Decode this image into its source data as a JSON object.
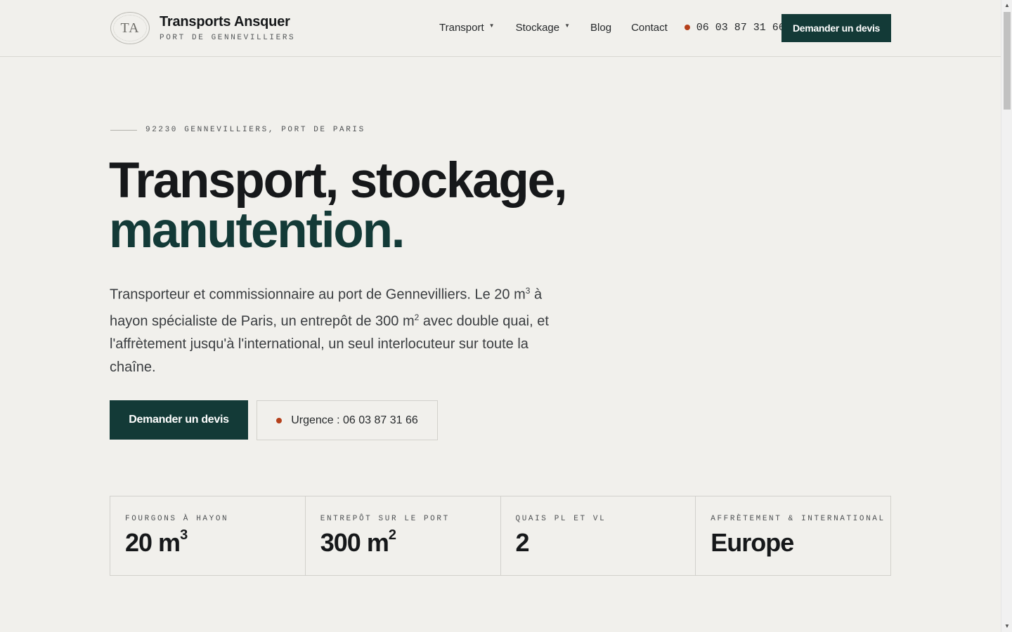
{
  "brand": {
    "logo_text": "TA",
    "name": "Transports Ansquer",
    "tagline": "PORT DE GENNEVILLIERS"
  },
  "nav": {
    "items": [
      {
        "label": "Transport",
        "has_dropdown": true
      },
      {
        "label": "Stockage",
        "has_dropdown": true
      },
      {
        "label": "Blog",
        "has_dropdown": false
      },
      {
        "label": "Contact",
        "has_dropdown": false
      }
    ],
    "phone": "06 03 87 31 66",
    "cta": "Demander un devis"
  },
  "hero": {
    "eyebrow": "92230 GENNEVILLIERS, PORT DE PARIS",
    "headline_1": "Transport, stockage,",
    "headline_2": "manutention.",
    "lead_1": "Transporteur et commissionnaire au port de Gennevilliers. Le 20 m",
    "lead_sup_1": "3",
    "lead_2": " à hayon spécialiste de Paris, un entrepôt de 300 m",
    "lead_sup_2": "2",
    "lead_3": " avec double quai, et l'affrètement jusqu'à l'international, un seul interlocuteur sur toute la chaîne.",
    "primary_cta": "Demander un devis",
    "secondary_cta": "Urgence : 06 03 87 31 66"
  },
  "stats": [
    {
      "label": "FOURGONS À HAYON",
      "value": "20 m",
      "sup": "3"
    },
    {
      "label": "ENTREPÔT SUR LE PORT",
      "value": "300 m",
      "sup": "2"
    },
    {
      "label": "QUAIS PL ET VL",
      "value": "2",
      "sup": ""
    },
    {
      "label": "AFFRÈTEMENT & INTERNATIONAL",
      "value": "Europe",
      "sup": ""
    }
  ],
  "colors": {
    "background": "#f1f0ec",
    "brand_green": "#133a37",
    "alert_dot": "#b5401b",
    "text": "#16181a"
  },
  "icons": {
    "dropdown": "caret-down-icon",
    "status": "red-dot-icon"
  }
}
